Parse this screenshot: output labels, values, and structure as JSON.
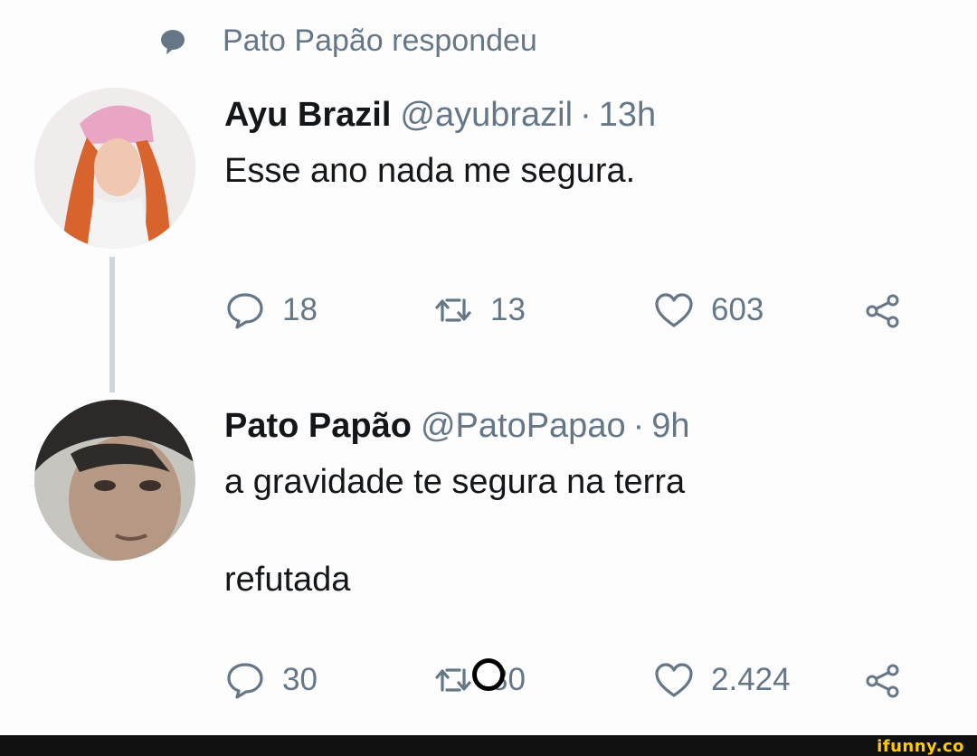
{
  "context": {
    "text": "Pato Papão respondeu",
    "icon": "speech-bubble-icon"
  },
  "tweets": [
    {
      "name": "Ayu Brazil",
      "handle": "@ayubrazil",
      "time": "13h",
      "separator": "·",
      "lines": [
        "Esse ano nada me segura."
      ],
      "replies": "18",
      "retweets": "13",
      "likes": "603"
    },
    {
      "name": "Pato Papão",
      "handle": "@PatoPapao",
      "time": "9h",
      "separator": "·",
      "lines": [
        "a gravidade te segura na terra",
        "refutada"
      ],
      "replies": "30",
      "retweets": "80",
      "likes": "2.424"
    }
  ],
  "watermark": "ifunny.co",
  "colors": {
    "muted": "#657786",
    "text": "#14171a",
    "watermark": "#ffcc00",
    "footer": "#101010"
  }
}
